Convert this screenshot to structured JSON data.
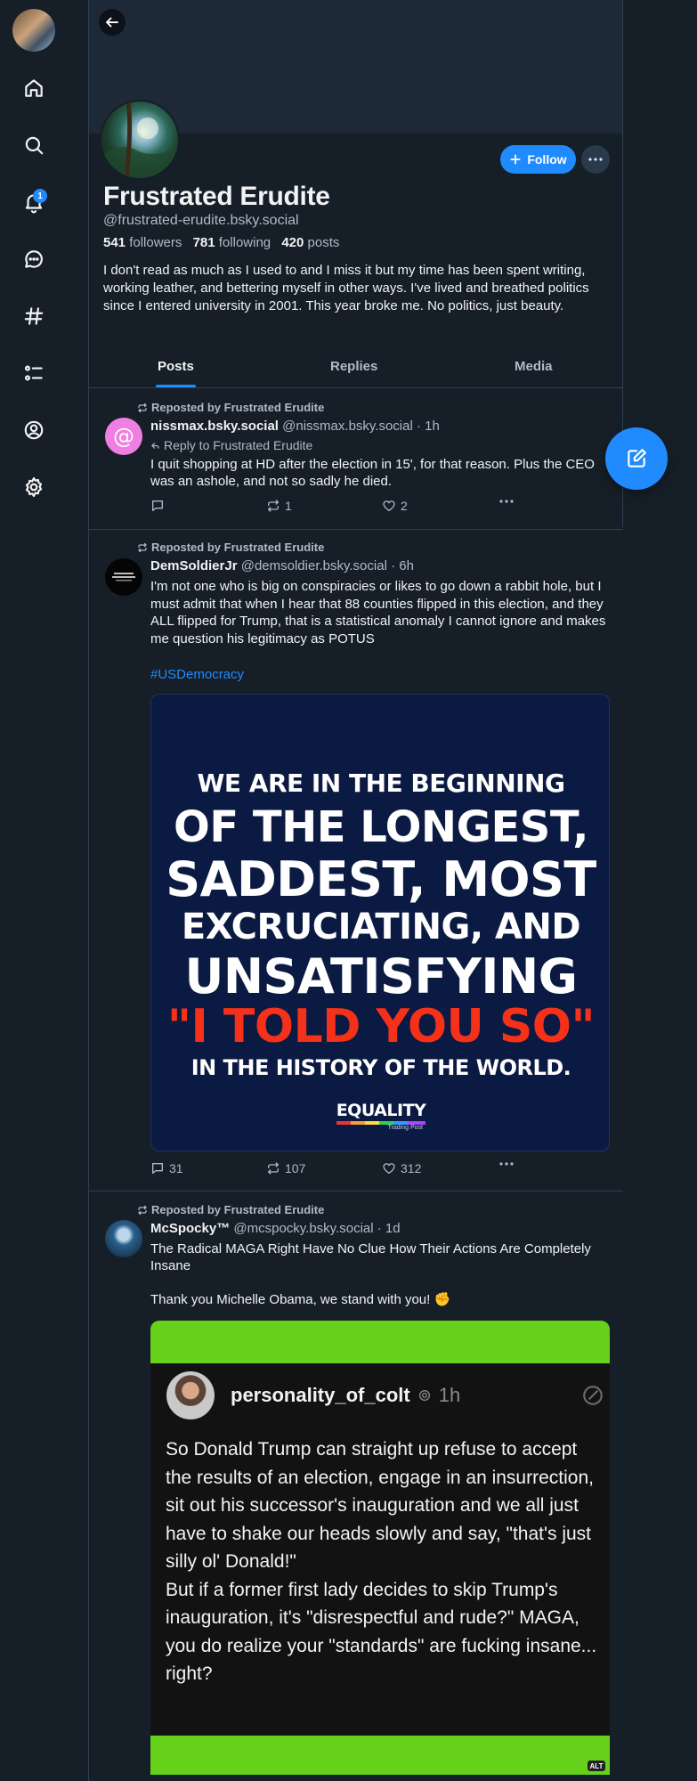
{
  "nav": {
    "items": [
      "home",
      "search",
      "notifications",
      "chat",
      "feeds",
      "lists",
      "profile",
      "settings"
    ],
    "notification_count": "1"
  },
  "profile": {
    "display_name": "Frustrated Erudite",
    "handle": "@frustrated-erudite.bsky.social",
    "followers_count": "541",
    "followers_label": "followers",
    "following_count": "781",
    "following_label": "following",
    "posts_count": "420",
    "posts_label": "posts",
    "bio": "I don't read as much as I used to and I miss it but my time has been spent writing, working leather, and bettering myself in other ways. I've lived and breathed politics since I entered university in 2001. This year broke me. No politics, just beauty.",
    "follow_label": "Follow"
  },
  "tabs": [
    {
      "label": "Posts",
      "active": true
    },
    {
      "label": "Replies",
      "active": false
    },
    {
      "label": "Media",
      "active": false
    }
  ],
  "posts": [
    {
      "repost_label": "Reposted by Frustrated Erudite",
      "author_name": "nissmax.bsky.social",
      "author_handle": "@nissmax.bsky.social",
      "time": "· 1h",
      "reply_to": "Reply to Frustrated Erudite",
      "text": "I quit shopping at HD after the election in 15', for that reason.  Plus the CEO was an ashole, and not so sadly he died.",
      "replies": "",
      "reposts": "1",
      "likes": "2"
    },
    {
      "repost_label": "Reposted by Frustrated Erudite",
      "author_name": "DemSoldierJr",
      "author_handle": "@demsoldier.bsky.social",
      "time": "· 6h",
      "text": "I'm not one who is big on conspiracies or likes to go down a rabbit hole, but I must admit that when I hear that 88 counties flipped in this election, and they ALL flipped for Trump, that is a statistical anomaly I cannot ignore and makes me question his legitimacy as POTUS",
      "hashtag": "#USDemocracy",
      "image": {
        "lines": [
          "WE ARE IN THE BEGINNING",
          "OF THE LONGEST,",
          "SADDEST, MOST",
          "EXCRUCIATING, AND",
          "UNSATISFYING",
          "\"I TOLD YOU SO\"",
          "IN THE HISTORY OF THE WORLD."
        ],
        "logo": "EQUALITY",
        "logo_sub": "Trading Post"
      },
      "replies": "31",
      "reposts": "107",
      "likes": "312"
    },
    {
      "repost_label": "Reposted by Frustrated Erudite",
      "author_name": "McSpocky™",
      "author_handle": "@mcspocky.bsky.social",
      "time": "· 1d",
      "text": "The Radical MAGA Right Have No Clue How Their Actions Are Completely Insane\n\nThank you Michelle Obama, we stand with you! ✊",
      "image": {
        "name": "personality_of_colt",
        "time": "1h",
        "text": "So Donald Trump can straight up refuse to accept the results of an election, engage in an insurrection, sit out his successor's inauguration and we all just have to shake our heads slowly and say, \"that's just silly ol' Donald!\"\nBut if a former first lady decides to skip Trump's inauguration, it's \"disrespectful and rude?\" MAGA, you do realize your \"standards\" are fucking insane... right?",
        "alt": "ALT"
      }
    }
  ],
  "colors": {
    "background": "#161e27",
    "accent": "#208bfe",
    "border": "#2e4052",
    "muted_text": "#aebbc9",
    "green": "#65d11b",
    "red": "#f5311a"
  }
}
